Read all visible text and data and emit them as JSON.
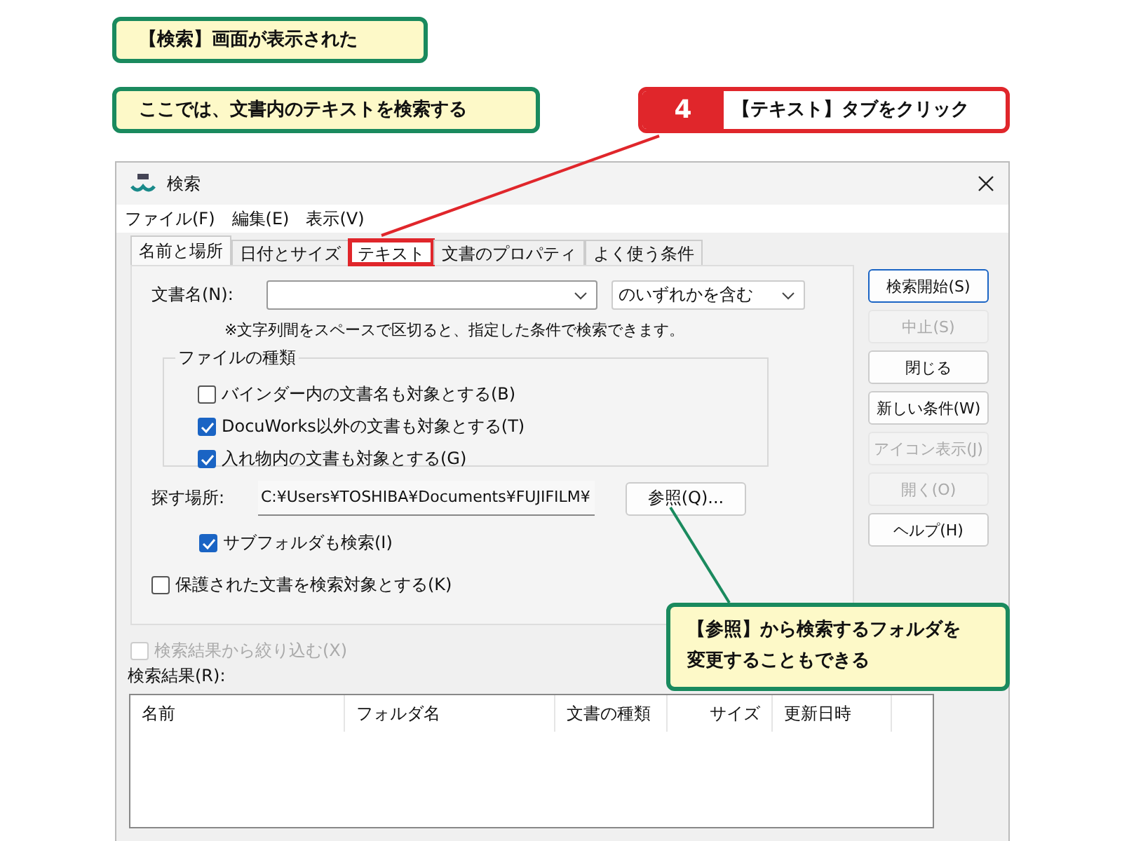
{
  "annotations": {
    "notes": [
      {
        "text": "【検索】画面が表示された"
      },
      {
        "text": "ここでは、文書内のテキストを検索する"
      }
    ],
    "step": {
      "number": "4",
      "text": "【テキスト】タブをクリック"
    },
    "tip": {
      "lines": [
        "【参照】から検索するフォルダを",
        "変更することもできる"
      ]
    }
  },
  "window": {
    "title": "検索"
  },
  "menu": [
    "ファイル(F)",
    "編集(E)",
    "表示(V)"
  ],
  "tabs": [
    {
      "label": "名前と場所",
      "selected": true,
      "highlighted": false
    },
    {
      "label": "日付とサイズ",
      "selected": false,
      "highlighted": false
    },
    {
      "label": "テキスト",
      "selected": false,
      "highlighted": true
    },
    {
      "label": "文書のプロパティ",
      "selected": false,
      "highlighted": false
    },
    {
      "label": "よく使う条件",
      "selected": false,
      "highlighted": false
    }
  ],
  "form": {
    "doc_name_label": "文書名(N):",
    "match": "のいずれかを含む",
    "note": "※文字列間をスペースで区切ると、指定した条件で検索できます。",
    "file_types": {
      "legend": "ファイルの種類",
      "options": [
        {
          "label": "バインダー内の文書名も対象とする(B)",
          "checked": false
        },
        {
          "label": "DocuWorks以外の文書も対象とする(T)",
          "checked": true
        },
        {
          "label": "入れ物内の文書も対象とする(G)",
          "checked": true
        }
      ]
    },
    "location_label": "探す場所:",
    "location": "C:¥Users¥TOSHIBA¥Documents¥FUJIFILM¥",
    "browse": "参照(Q)...",
    "subfolders": {
      "label": "サブフォルダも検索(I)",
      "checked": true
    },
    "protected": {
      "label": "保護された文書を検索対象とする(K)",
      "checked": false
    }
  },
  "buttons": [
    {
      "label": "検索開始(S)",
      "disabled": false,
      "default": true
    },
    {
      "label": "中止(S)",
      "disabled": true,
      "default": false
    },
    {
      "label": "閉じる",
      "disabled": false,
      "default": false
    },
    {
      "label": "新しい条件(W)",
      "disabled": false,
      "default": false
    },
    {
      "label": "アイコン表示(J)",
      "disabled": true,
      "default": false
    },
    {
      "label": "開く(O)",
      "disabled": true,
      "default": false
    },
    {
      "label": "ヘルプ(H)",
      "disabled": false,
      "default": false
    }
  ],
  "refine": {
    "label": "検索結果から絞り込む(X)",
    "checked": false,
    "disabled": true
  },
  "results": {
    "label": "検索結果(R):",
    "columns": [
      {
        "label": "名前"
      },
      {
        "label": "フォルダ名"
      },
      {
        "label": "文書の種類"
      },
      {
        "label": "サイズ"
      },
      {
        "label": "更新日時"
      }
    ]
  }
}
